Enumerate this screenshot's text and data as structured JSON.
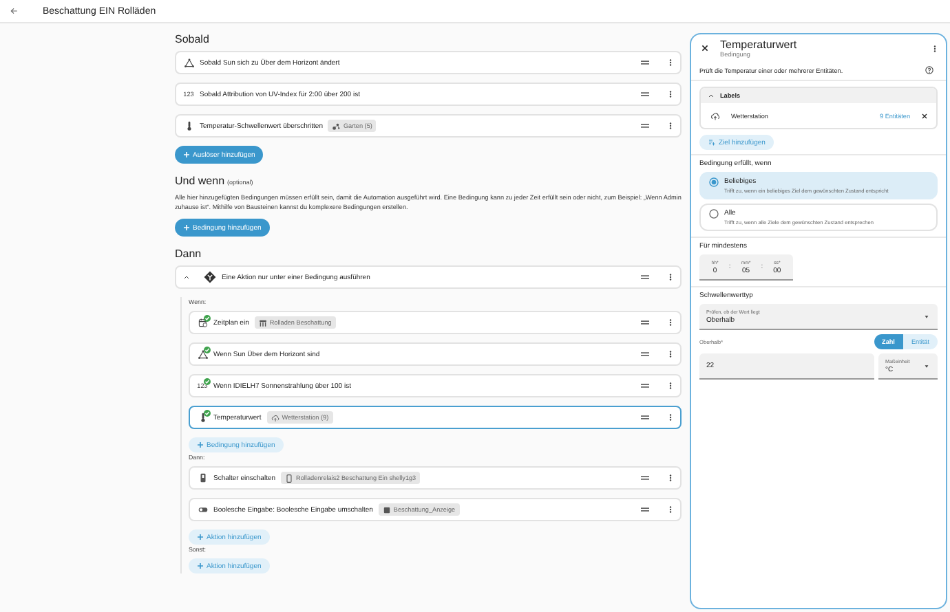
{
  "header": {
    "title": "Beschattung EIN Rolläden"
  },
  "triggers": {
    "heading": "Sobald",
    "items": [
      {
        "kind": "sun",
        "text": "Sobald Sun sich zu Über dem Horizont ändert"
      },
      {
        "kind": "numeric",
        "icon_text": "123",
        "text": "Sobald Attribution von UV-Index für 2:00 über 200 ist"
      },
      {
        "kind": "temperature",
        "text": "Temperatur-Schwellenwert überschritten",
        "chip": {
          "kind": "area",
          "label": "Garten (5)"
        }
      }
    ],
    "add_button": "Auslöser hinzufügen"
  },
  "conditions": {
    "heading": "Und wenn",
    "heading_note": "(optional)",
    "description": "Alle hier hinzugefügten Bedingungen müssen erfüllt sein, damit die Automation ausgeführt wird. Eine Bedingung kann zu jeder Zeit erfüllt sein oder nicht, zum Beispiel: „Wenn Admin zuhause ist“. Mithilfe von Bausteinen kannst du komplexere Bedingungen erstellen.",
    "add_button": "Bedingung hinzufügen"
  },
  "actions": {
    "heading": "Dann",
    "items": [
      {
        "kind": "if",
        "expanded": true,
        "text": "Eine Aktion nur unter einer Bedingung ausführen",
        "if_label": "Wenn:",
        "conditions": [
          {
            "kind": "schedule",
            "text": "Zeitplan ein",
            "chip": {
              "kind": "schedule",
              "label": "Rolladen Beschattung"
            },
            "valid": true,
            "selected": false
          },
          {
            "kind": "sun",
            "text": "Wenn Sun Über dem Horizont sind",
            "valid": true,
            "selected": false
          },
          {
            "kind": "numeric",
            "icon_text": "123",
            "text": "Wenn IDIELH7 Sonnenstrahlung über 100 ist",
            "valid": true,
            "selected": false
          },
          {
            "kind": "temperature",
            "text": "Temperaturwert",
            "chip": {
              "kind": "label",
              "label": "Wetterstation (9)"
            },
            "valid": true,
            "selected": true
          }
        ],
        "add_condition": "Bedingung hinzufügen",
        "then_label": "Dann:",
        "then": [
          {
            "kind": "switch",
            "text": "Schalter einschalten",
            "chip": {
              "kind": "device",
              "label": "Rolladenrelais2 Beschattung Ein shelly1g3"
            }
          },
          {
            "kind": "boolean",
            "text": "Boolesche Eingabe: Boolesche Eingabe umschalten",
            "chip": {
              "kind": "entity",
              "label": "Beschattung_Anzeige"
            }
          }
        ],
        "add_action": "Aktion hinzufügen",
        "else_label": "Sonst:",
        "add_else_action": "Aktion hinzufügen"
      }
    ]
  },
  "panel": {
    "title": "Temperaturwert",
    "subtitle": "Bedingung",
    "description": "Prüft die Temperatur einer oder mehrerer Entitäten.",
    "targets": {
      "heading": "Labels",
      "expanded": true,
      "items": [
        {
          "label": "Wetterstation",
          "count": "9 Entitäten"
        }
      ],
      "add_button": "Ziel hinzufügen"
    },
    "match": {
      "label": "Bedingung erfüllt, wenn",
      "options": [
        {
          "label": "Beliebiges",
          "hint": "Trifft zu, wenn ein beliebiges Ziel dem gewünschten Zustand entspricht",
          "selected": true
        },
        {
          "label": "Alle",
          "hint": "Trifft zu, wenn alle Ziele dem gewünschten Zustand entsprechen",
          "selected": false
        }
      ]
    },
    "duration": {
      "label": "Für mindestens",
      "separator": ":",
      "fields": [
        {
          "label": "hh*",
          "value": "0"
        },
        {
          "label": "mm*",
          "value": "05"
        },
        {
          "label": "ss*",
          "value": "00"
        }
      ]
    },
    "threshold": {
      "label": "Schwellenwerttyp",
      "select": {
        "label": "Prüfen, ob der Wert liegt",
        "value": "Oberhalb"
      },
      "above_label": "Oberhalb*",
      "modes": [
        {
          "label": "Zahl",
          "selected": true
        },
        {
          "label": "Entität",
          "selected": false
        }
      ],
      "value": "22",
      "unit": {
        "label": "Maßeinheit",
        "value": "°C"
      }
    }
  }
}
